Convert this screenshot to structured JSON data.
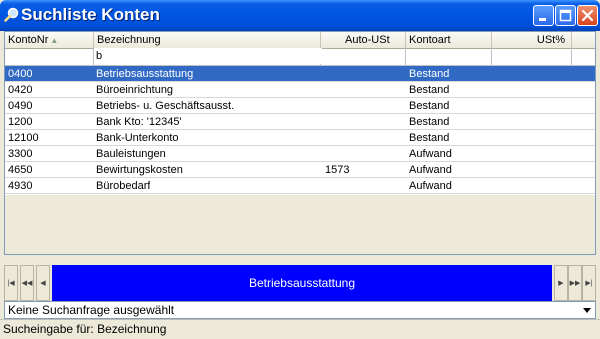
{
  "window": {
    "title": "Suchliste Konten"
  },
  "columns": [
    {
      "key": "konto",
      "label": "KontoNr"
    },
    {
      "key": "bezeichnung",
      "label": "Bezeichnung"
    },
    {
      "key": "autoust",
      "label": "Auto-USt"
    },
    {
      "key": "kontoart",
      "label": "Kontoart"
    },
    {
      "key": "ust",
      "label": "USt%"
    }
  ],
  "filter": {
    "bezeichnung": "b"
  },
  "rows": [
    {
      "konto": "0400",
      "bezeichnung": "Betriebsausstattung",
      "autoust": "",
      "kontoart": "Bestand",
      "ust": "",
      "selected": true
    },
    {
      "konto": "0420",
      "bezeichnung": "Büroeinrichtung",
      "autoust": "",
      "kontoart": "Bestand",
      "ust": ""
    },
    {
      "konto": "0490",
      "bezeichnung": "Betriebs- u. Geschäftsausst.",
      "autoust": "",
      "kontoart": "Bestand",
      "ust": ""
    },
    {
      "konto": "1200",
      "bezeichnung": "Bank Kto: '12345'",
      "autoust": "",
      "kontoart": "Bestand",
      "ust": ""
    },
    {
      "konto": "12100",
      "bezeichnung": "Bank-Unterkonto",
      "autoust": "",
      "kontoart": "Bestand",
      "ust": ""
    },
    {
      "konto": "3300",
      "bezeichnung": "Bauleistungen",
      "autoust": "",
      "kontoart": "Aufwand",
      "ust": ""
    },
    {
      "konto": "4650",
      "bezeichnung": "Bewirtungskosten",
      "autoust": "1573",
      "kontoart": "Aufwand",
      "ust": ""
    },
    {
      "konto": "4930",
      "bezeichnung": "Bürobedarf",
      "autoust": "",
      "kontoart": "Aufwand",
      "ust": ""
    }
  ],
  "navigator": {
    "current_label": "Betriebsausstattung",
    "first_icon": "first-record-icon",
    "prev_page_icon": "prev-page-icon",
    "prev_icon": "prev-record-icon",
    "next_icon": "next-record-icon",
    "next_page_icon": "next-page-icon",
    "last_icon": "last-record-icon",
    "accent_color": "#0000ff"
  },
  "query_select": {
    "value": "Keine Suchanfrage ausgewählt"
  },
  "status": {
    "text": "Sucheingabe für: Bezeichnung"
  },
  "colors": {
    "titlebar": "#0054e3",
    "selection": "#316ac5",
    "face": "#ece9d8"
  }
}
